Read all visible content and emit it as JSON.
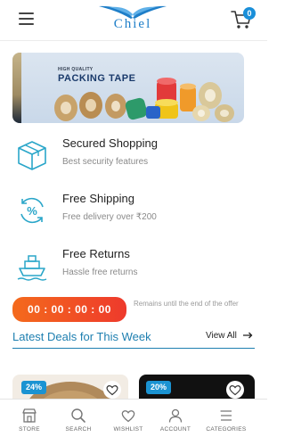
{
  "header": {
    "menu_icon": "hamburger-menu-icon",
    "logo_text": "Chiel",
    "cart_icon": "cart-icon",
    "cart_count": "0"
  },
  "banner": {
    "kicker": "HIGH QUALITY",
    "title": "PACKING TAPE"
  },
  "features": [
    {
      "icon": "package-box-icon",
      "title": "Secured Shopping",
      "subtitle": "Best security features"
    },
    {
      "icon": "percent-cycle-icon",
      "title": "Free Shipping",
      "subtitle": "Free delivery over ₹200"
    },
    {
      "icon": "ship-icon",
      "title": "Free Returns",
      "subtitle": "Hassle free returns"
    }
  ],
  "timer": {
    "value": "00 : 00 : 00 : 00",
    "note": "Remains until the end of the offer"
  },
  "deals": {
    "title": "Latest Deals for This Week",
    "view_all": "View All",
    "products": [
      {
        "discount": "24%"
      },
      {
        "discount": "20%"
      }
    ]
  },
  "bottom_nav": [
    {
      "label": "STORE",
      "icon": "store-icon"
    },
    {
      "label": "SEARCH",
      "icon": "search-icon"
    },
    {
      "label": "WISHLIST",
      "icon": "heart-icon"
    },
    {
      "label": "ACCOUNT",
      "icon": "user-icon"
    },
    {
      "label": "CATEGORIES",
      "icon": "list-icon"
    }
  ],
  "colors": {
    "brand_blue": "#1e7ec8",
    "accent_link": "#1e7fb0",
    "badge_blue": "#1b93d2",
    "timer_orange": "#f46a1c",
    "timer_red": "#ee3a2c"
  }
}
